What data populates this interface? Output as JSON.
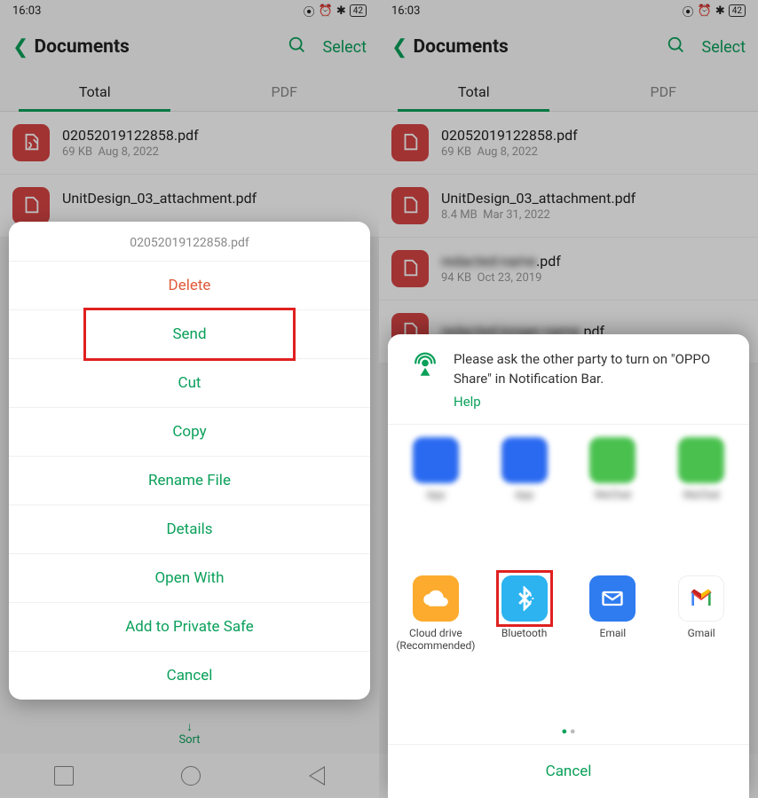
{
  "status": {
    "time": "16:03",
    "battery": "42"
  },
  "header": {
    "title": "Documents",
    "select": "Select"
  },
  "tabs": {
    "total": "Total",
    "pdf": "PDF"
  },
  "files": [
    {
      "name": "02052019122858.pdf",
      "size": "69 KB",
      "date": "Aug 8, 2022"
    },
    {
      "name": "UnitDesign_03_attachment.pdf",
      "size": "8.4 MB",
      "date": "Mar 31, 2022"
    },
    {
      "name": "████████████.pdf",
      "size": "94 KB",
      "date": "Oct 23, 2019"
    },
    {
      "name": "██████████████.pdf",
      "size": "",
      "date": ""
    }
  ],
  "sort": "Sort",
  "ctx": {
    "title": "02052019122858.pdf",
    "delete": "Delete",
    "send": "Send",
    "cut": "Cut",
    "copy": "Copy",
    "rename": "Rename File",
    "details": "Details",
    "openwith": "Open With",
    "private": "Add to Private Safe",
    "cancel": "Cancel"
  },
  "share": {
    "hint": "Please ask the other party to turn on \"OPPO Share\" in Notification Bar.",
    "help": "Help",
    "apps": {
      "cloud": "Cloud drive",
      "cloud2": "(Recommended)",
      "bt": "Bluetooth",
      "email": "Email",
      "gmail": "Gmail"
    },
    "cancel": "Cancel"
  }
}
